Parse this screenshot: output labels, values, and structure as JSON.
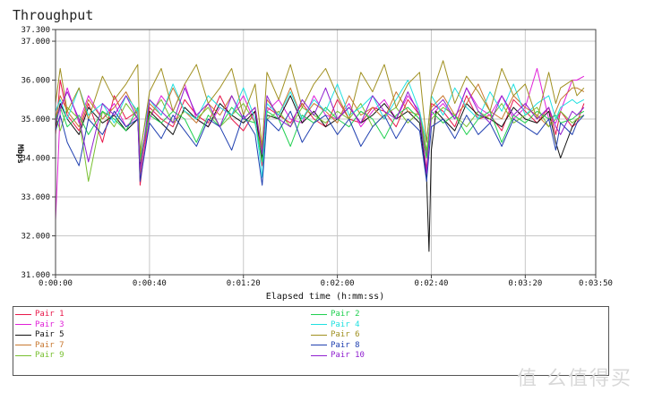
{
  "chart_data": {
    "type": "line",
    "title": "Throughput",
    "xlabel": "Elapsed time (h:mm:ss)",
    "ylabel": "Mbps",
    "xlim": [
      0,
      230
    ],
    "ylim": [
      31.0,
      37.3
    ],
    "x_ticks": [
      {
        "value": 0,
        "label": "0:00:00"
      },
      {
        "value": 40,
        "label": "0:00:40"
      },
      {
        "value": 80,
        "label": "0:01:20"
      },
      {
        "value": 120,
        "label": "0:02:00"
      },
      {
        "value": 160,
        "label": "0:02:40"
      },
      {
        "value": 200,
        "label": "0:03:20"
      },
      {
        "value": 230,
        "label": "0:03:50"
      }
    ],
    "y_ticks": [
      {
        "value": 31.0,
        "label": "31.000"
      },
      {
        "value": 32.0,
        "label": "32.000"
      },
      {
        "value": 33.0,
        "label": "33.000"
      },
      {
        "value": 34.0,
        "label": "34.000"
      },
      {
        "value": 35.0,
        "label": "35.000"
      },
      {
        "value": 36.0,
        "label": "36.000"
      },
      {
        "value": 37.0,
        "label": "37.000"
      },
      {
        "value": 37.3,
        "label": "37.300"
      }
    ],
    "grid": true,
    "legend_position": "bottom",
    "series": [
      {
        "name": "Pair 1",
        "color": "#e8184a",
        "x": [
          0,
          2,
          5,
          10,
          14,
          20,
          25,
          30,
          35,
          36,
          40,
          45,
          50,
          55,
          60,
          65,
          70,
          75,
          80,
          85,
          88,
          90,
          95,
          100,
          105,
          110,
          115,
          120,
          125,
          130,
          135,
          140,
          145,
          150,
          155,
          158,
          160,
          165,
          170,
          175,
          180,
          185,
          190,
          195,
          200,
          205,
          210,
          213,
          215,
          220,
          222,
          225
        ],
        "y": [
          34.6,
          36.0,
          35.1,
          34.7,
          35.4,
          34.4,
          35.6,
          35.0,
          35.2,
          33.3,
          35.3,
          35.0,
          34.8,
          35.5,
          35.1,
          34.9,
          35.6,
          35.0,
          34.7,
          35.2,
          33.8,
          35.3,
          35.1,
          34.9,
          35.4,
          35.0,
          34.8,
          35.5,
          35.0,
          34.9,
          35.3,
          35.2,
          34.8,
          35.5,
          35.1,
          33.7,
          35.4,
          35.2,
          34.8,
          35.6,
          35.0,
          35.1,
          34.7,
          35.5,
          35.2,
          34.9,
          35.3,
          34.6,
          35.2,
          34.8,
          34.9,
          35.4
        ]
      },
      {
        "name": "Pair 3",
        "color": "#e020d8",
        "x": [
          0,
          2,
          5,
          10,
          14,
          20,
          25,
          30,
          35,
          36,
          40,
          45,
          50,
          55,
          60,
          65,
          70,
          75,
          80,
          85,
          88,
          90,
          95,
          100,
          105,
          110,
          115,
          120,
          125,
          130,
          135,
          140,
          145,
          150,
          155,
          158,
          160,
          165,
          170,
          175,
          180,
          185,
          190,
          195,
          200,
          205,
          210,
          213,
          215,
          220,
          222,
          225
        ],
        "y": [
          32.4,
          35.2,
          35.8,
          34.9,
          35.6,
          35.0,
          35.4,
          34.8,
          35.1,
          33.5,
          35.0,
          35.6,
          35.2,
          35.9,
          35.0,
          34.8,
          35.3,
          35.1,
          35.6,
          34.9,
          34.0,
          35.2,
          35.5,
          35.0,
          34.9,
          35.6,
          35.1,
          35.0,
          35.4,
          34.8,
          35.2,
          35.5,
          35.0,
          35.6,
          35.2,
          34.1,
          35.1,
          35.4,
          35.0,
          35.8,
          35.3,
          35.1,
          35.6,
          35.0,
          35.3,
          36.3,
          35.0,
          34.9,
          35.2,
          36.0,
          36.0,
          36.1
        ]
      },
      {
        "name": "Pair 5",
        "color": "#111111",
        "x": [
          0,
          2,
          5,
          10,
          14,
          20,
          25,
          30,
          35,
          36,
          40,
          45,
          50,
          55,
          60,
          65,
          70,
          75,
          80,
          85,
          88,
          90,
          95,
          100,
          105,
          110,
          115,
          120,
          125,
          130,
          135,
          140,
          145,
          150,
          155,
          158,
          159,
          160,
          162,
          165,
          170,
          175,
          180,
          185,
          190,
          195,
          200,
          205,
          210,
          213,
          215,
          220,
          222,
          225
        ],
        "y": [
          34.8,
          35.4,
          35.0,
          34.6,
          35.3,
          34.9,
          35.1,
          34.7,
          35.0,
          33.8,
          35.2,
          34.9,
          34.6,
          35.3,
          35.0,
          34.8,
          35.4,
          35.1,
          34.9,
          35.2,
          34.0,
          35.1,
          35.0,
          35.6,
          34.9,
          35.2,
          34.8,
          35.0,
          35.3,
          34.9,
          35.1,
          35.4,
          35.0,
          35.2,
          34.9,
          33.5,
          31.6,
          34.2,
          35.2,
          35.0,
          34.7,
          35.4,
          35.1,
          35.0,
          34.8,
          35.3,
          35.0,
          34.9,
          35.2,
          34.4,
          34.0,
          34.8,
          35.0,
          35.1
        ]
      },
      {
        "name": "Pair 7",
        "color": "#c87830",
        "x": [
          0,
          2,
          5,
          10,
          14,
          20,
          25,
          30,
          35,
          36,
          40,
          45,
          50,
          55,
          60,
          65,
          70,
          75,
          80,
          85,
          88,
          90,
          95,
          100,
          105,
          110,
          115,
          120,
          125,
          130,
          135,
          140,
          145,
          150,
          155,
          158,
          160,
          165,
          170,
          175,
          180,
          185,
          190,
          195,
          200,
          205,
          210,
          213,
          215,
          220,
          222,
          225
        ],
        "y": [
          35.0,
          35.6,
          35.2,
          34.8,
          35.5,
          35.0,
          35.3,
          35.7,
          35.1,
          33.6,
          35.4,
          35.1,
          35.8,
          35.2,
          34.9,
          35.4,
          35.1,
          35.6,
          35.0,
          35.3,
          34.2,
          35.5,
          35.1,
          35.8,
          35.0,
          35.4,
          35.2,
          34.9,
          35.6,
          35.1,
          35.3,
          35.0,
          35.7,
          35.2,
          35.1,
          34.0,
          35.3,
          35.6,
          35.1,
          35.4,
          35.9,
          35.2,
          35.0,
          35.6,
          35.3,
          35.1,
          34.8,
          35.2,
          35.5,
          35.8,
          35.8,
          35.7
        ]
      },
      {
        "name": "Pair 9",
        "color": "#78c030",
        "x": [
          0,
          2,
          5,
          10,
          14,
          20,
          25,
          30,
          35,
          36,
          40,
          45,
          50,
          55,
          60,
          65,
          70,
          75,
          80,
          85,
          88,
          90,
          95,
          100,
          105,
          110,
          115,
          120,
          125,
          130,
          135,
          140,
          145,
          150,
          155,
          158,
          160,
          165,
          170,
          175,
          180,
          185,
          190,
          195,
          200,
          205,
          210,
          213,
          215,
          220,
          222,
          225
        ],
        "y": [
          35.1,
          34.7,
          35.3,
          35.0,
          33.4,
          35.2,
          34.8,
          35.4,
          35.0,
          33.9,
          35.1,
          35.5,
          34.9,
          35.2,
          35.0,
          35.3,
          34.8,
          35.1,
          35.4,
          34.9,
          34.1,
          35.0,
          35.2,
          34.8,
          35.3,
          35.1,
          34.9,
          35.2,
          35.0,
          35.4,
          34.8,
          35.1,
          35.3,
          34.9,
          35.2,
          34.2,
          35.0,
          35.3,
          35.1,
          34.8,
          35.2,
          35.0,
          35.4,
          34.9,
          35.1,
          35.3,
          34.8,
          35.0,
          35.2,
          34.9,
          35.0,
          35.1
        ]
      },
      {
        "name": "Pair 2",
        "color": "#20d050",
        "x": [
          0,
          2,
          5,
          10,
          14,
          20,
          25,
          30,
          35,
          36,
          40,
          45,
          50,
          55,
          60,
          65,
          70,
          75,
          80,
          85,
          88,
          90,
          95,
          100,
          105,
          110,
          115,
          120,
          125,
          130,
          135,
          140,
          145,
          150,
          155,
          158,
          160,
          165,
          170,
          175,
          180,
          185,
          190,
          195,
          200,
          205,
          210,
          213,
          215,
          220,
          222,
          225
        ],
        "y": [
          35.0,
          35.3,
          34.8,
          35.1,
          34.6,
          35.2,
          35.0,
          34.7,
          35.3,
          34.0,
          35.1,
          34.9,
          35.2,
          35.0,
          34.4,
          35.1,
          34.8,
          35.3,
          35.0,
          34.9,
          33.9,
          35.2,
          35.0,
          34.3,
          35.1,
          34.9,
          35.3,
          35.0,
          34.8,
          35.2,
          35.0,
          34.5,
          35.1,
          35.3,
          35.0,
          34.0,
          35.2,
          34.9,
          35.1,
          34.6,
          35.0,
          35.2,
          34.4,
          35.1,
          34.9,
          35.2,
          35.0,
          35.1,
          34.9,
          35.0,
          35.1,
          35.2
        ]
      },
      {
        "name": "Pair 4",
        "color": "#20e0e0",
        "x": [
          0,
          2,
          5,
          10,
          14,
          20,
          25,
          30,
          35,
          36,
          40,
          45,
          50,
          55,
          60,
          65,
          70,
          75,
          80,
          85,
          88,
          90,
          95,
          100,
          105,
          110,
          115,
          120,
          125,
          130,
          135,
          140,
          145,
          150,
          155,
          158,
          160,
          165,
          170,
          175,
          180,
          185,
          190,
          195,
          200,
          205,
          210,
          213,
          215,
          220,
          222,
          225
        ],
        "y": [
          35.2,
          35.5,
          35.0,
          35.8,
          35.1,
          35.4,
          34.9,
          35.6,
          35.2,
          34.2,
          35.5,
          35.1,
          35.9,
          35.2,
          35.0,
          35.6,
          35.3,
          35.1,
          35.8,
          35.0,
          33.5,
          35.4,
          35.1,
          35.7,
          35.0,
          35.5,
          35.2,
          35.9,
          35.1,
          35.3,
          35.6,
          35.0,
          35.5,
          36.0,
          35.2,
          34.4,
          35.6,
          35.1,
          35.8,
          35.3,
          35.0,
          35.7,
          35.2,
          35.9,
          35.1,
          35.4,
          35.6,
          35.0,
          35.3,
          35.5,
          35.4,
          35.5
        ]
      },
      {
        "name": "Pair 6",
        "color": "#a09020",
        "x": [
          0,
          2,
          5,
          10,
          14,
          20,
          25,
          30,
          35,
          36,
          40,
          45,
          50,
          55,
          60,
          65,
          70,
          75,
          80,
          85,
          88,
          90,
          95,
          100,
          105,
          110,
          115,
          120,
          125,
          130,
          135,
          140,
          145,
          150,
          155,
          158,
          160,
          165,
          170,
          175,
          180,
          185,
          190,
          195,
          200,
          205,
          210,
          213,
          215,
          220,
          222,
          225
        ],
        "y": [
          35.4,
          36.3,
          35.2,
          35.8,
          35.0,
          36.1,
          35.5,
          35.9,
          36.4,
          34.1,
          35.7,
          36.3,
          35.2,
          35.9,
          36.4,
          35.4,
          35.8,
          36.3,
          35.1,
          35.9,
          34.3,
          36.2,
          35.5,
          36.4,
          35.3,
          35.9,
          36.3,
          35.6,
          35.0,
          36.2,
          35.7,
          36.4,
          35.3,
          35.9,
          36.2,
          34.4,
          35.6,
          36.5,
          35.4,
          36.1,
          35.7,
          35.2,
          36.3,
          35.6,
          35.9,
          35.0,
          36.2,
          35.4,
          35.8,
          36.0,
          35.6,
          35.8
        ]
      },
      {
        "name": "Pair 8",
        "color": "#2040b0",
        "x": [
          0,
          2,
          5,
          10,
          14,
          20,
          25,
          30,
          35,
          36,
          40,
          45,
          50,
          55,
          60,
          65,
          70,
          75,
          80,
          85,
          88,
          90,
          95,
          100,
          105,
          110,
          115,
          120,
          125,
          130,
          135,
          140,
          145,
          150,
          155,
          158,
          160,
          165,
          170,
          175,
          180,
          185,
          190,
          195,
          200,
          205,
          210,
          213,
          215,
          220,
          222,
          225
        ],
        "y": [
          34.7,
          35.1,
          34.4,
          33.8,
          35.0,
          34.6,
          35.2,
          34.8,
          35.0,
          33.4,
          34.9,
          34.5,
          35.1,
          34.7,
          34.3,
          35.0,
          34.8,
          34.2,
          35.1,
          34.6,
          33.3,
          35.0,
          34.7,
          35.2,
          34.4,
          34.9,
          35.1,
          34.6,
          35.0,
          34.3,
          34.8,
          35.1,
          34.5,
          35.0,
          34.7,
          33.4,
          34.8,
          35.0,
          34.5,
          35.1,
          34.6,
          34.9,
          34.3,
          35.0,
          34.8,
          34.6,
          35.0,
          34.2,
          34.9,
          34.6,
          34.9,
          35.1
        ]
      },
      {
        "name": "Pair 10",
        "color": "#9020d0",
        "x": [
          0,
          2,
          5,
          10,
          14,
          20,
          25,
          30,
          35,
          36,
          40,
          45,
          50,
          55,
          60,
          65,
          70,
          75,
          80,
          85,
          88,
          90,
          95,
          100,
          105,
          110,
          115,
          120,
          125,
          130,
          135,
          140,
          145,
          150,
          155,
          158,
          160,
          165,
          170,
          175,
          180,
          185,
          190,
          195,
          200,
          205,
          210,
          213,
          215,
          220,
          222,
          225
        ],
        "y": [
          34.9,
          35.3,
          35.7,
          35.0,
          33.9,
          35.4,
          35.1,
          35.6,
          35.0,
          33.7,
          35.5,
          35.2,
          34.9,
          35.8,
          35.1,
          35.4,
          34.8,
          35.6,
          35.0,
          35.3,
          34.1,
          35.6,
          35.0,
          34.8,
          35.5,
          35.1,
          35.8,
          35.0,
          35.3,
          34.9,
          35.6,
          35.2,
          35.0,
          35.7,
          35.1,
          33.6,
          35.2,
          35.5,
          35.0,
          35.8,
          35.2,
          34.9,
          35.6,
          35.1,
          35.4,
          35.0,
          35.3,
          34.8,
          34.6,
          35.2,
          35.1,
          35.3
        ]
      }
    ]
  },
  "legend": {
    "left": [
      "Pair 1",
      "Pair 3",
      "Pair 5",
      "Pair 7",
      "Pair 9"
    ],
    "right": [
      "Pair 2",
      "Pair 4",
      "Pair 6",
      "Pair 8",
      "Pair 10"
    ]
  },
  "watermark": "值 么值得买"
}
